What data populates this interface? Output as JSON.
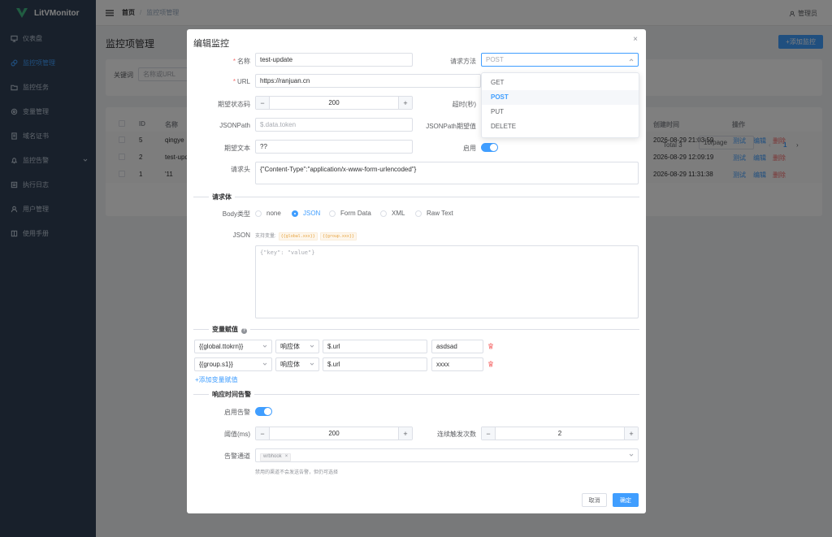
{
  "app": {
    "name": "LitVMonitor"
  },
  "sidebar": {
    "items": [
      {
        "label": "仪表盘",
        "icon": "monitor-icon"
      },
      {
        "label": "监控项管理",
        "icon": "link-icon",
        "active": true
      },
      {
        "label": "监控任务",
        "icon": "folder-icon"
      },
      {
        "label": "变量管理",
        "icon": "settings-icon"
      },
      {
        "label": "域名证书",
        "icon": "document-icon"
      },
      {
        "label": "监控告警",
        "icon": "bell-icon"
      },
      {
        "label": "执行日志",
        "icon": "list-icon"
      },
      {
        "label": "用户管理",
        "icon": "user-icon"
      },
      {
        "label": "使用手册",
        "icon": "book-icon"
      }
    ]
  },
  "header": {
    "breadcrumb_home": "首页",
    "breadcrumb_sep": "/",
    "breadcrumb_current": "监控项管理",
    "user": "管理员"
  },
  "page": {
    "title": "监控项管理",
    "add_button": "+添加监控",
    "search_label": "关键词",
    "search_placeholder": "名称或URL",
    "columns": {
      "id": "ID",
      "name": "名称",
      "created": "创建时间",
      "actions": "操作"
    },
    "rows": [
      {
        "id": "5",
        "name": "qingye",
        "created": "2026-08-29 21:03:59"
      },
      {
        "id": "2",
        "name": "test-upd",
        "created": "2026-08-29 12:09:19"
      },
      {
        "id": "1",
        "name": "'11",
        "created": "2026-08-29 11:31:38"
      }
    ],
    "row_actions": {
      "test": "测试",
      "edit": "编辑",
      "delete": "删除"
    },
    "pager": {
      "total": "Total 3",
      "size": "10/page",
      "prev": "‹",
      "current": "1",
      "next": "›"
    }
  },
  "dialog": {
    "title": "编辑监控",
    "close": "×",
    "fields": {
      "name_label": "名称",
      "name_value": "test-update",
      "method_label": "请求方法",
      "method_value": "POST",
      "url_label": "URL",
      "url_value": "https://ranjuan.cn",
      "status_label": "期望状态码",
      "status_value": "200",
      "timeout_label": "超时(秒)",
      "jsonpath_label": "JSONPath",
      "jsonpath_placeholder": "$.data.token",
      "jsonpath_expect_label": "JSONPath期望值",
      "expect_text_label": "期望文本",
      "expect_text_value": "??",
      "enabled_label": "启用",
      "headers_label": "请求头",
      "headers_value": "{\"Content-Type\":\"application/x-www-form-urlencoded\"}"
    },
    "body": {
      "section": "请求体",
      "type_label": "Body类型",
      "types": [
        "none",
        "JSON",
        "Form Data",
        "XML",
        "Raw Text"
      ],
      "selected": "JSON",
      "json_label": "JSON",
      "vars_hint": "支持变量:",
      "var_tags": [
        "{{global.xxx}}",
        "{{group.xxx}}"
      ],
      "json_placeholder": "{\"key\": \"value\"}"
    },
    "vars": {
      "section": "变量赋值",
      "help": "?",
      "rows": [
        {
          "target": "{{global.ttokrn}}",
          "source": "响应体",
          "path": "$.url",
          "value": "asdsad"
        },
        {
          "target": "{{group.s1}}",
          "source": "响应体",
          "path": "$.url",
          "value": "xxxx"
        }
      ],
      "add": "+添加变量赋值"
    },
    "alert": {
      "section": "响应时间告警",
      "enable_label": "启用告警",
      "threshold_label": "阈值(ms)",
      "threshold_value": "200",
      "consecutive_label": "连续触发次数",
      "consecutive_value": "2",
      "channel_label": "告警通道",
      "channel_chip": "wrbhook",
      "hint": "禁用的渠道不会发送告警，但仍可选择"
    },
    "buttons": {
      "cancel": "取消",
      "ok": "确定"
    }
  },
  "method_dropdown": {
    "options": [
      "GET",
      "POST",
      "PUT",
      "DELETE"
    ],
    "selected": "POST"
  },
  "colors": {
    "primary": "#409eff",
    "sidebar": "#304156",
    "danger": "#f56c6c"
  }
}
